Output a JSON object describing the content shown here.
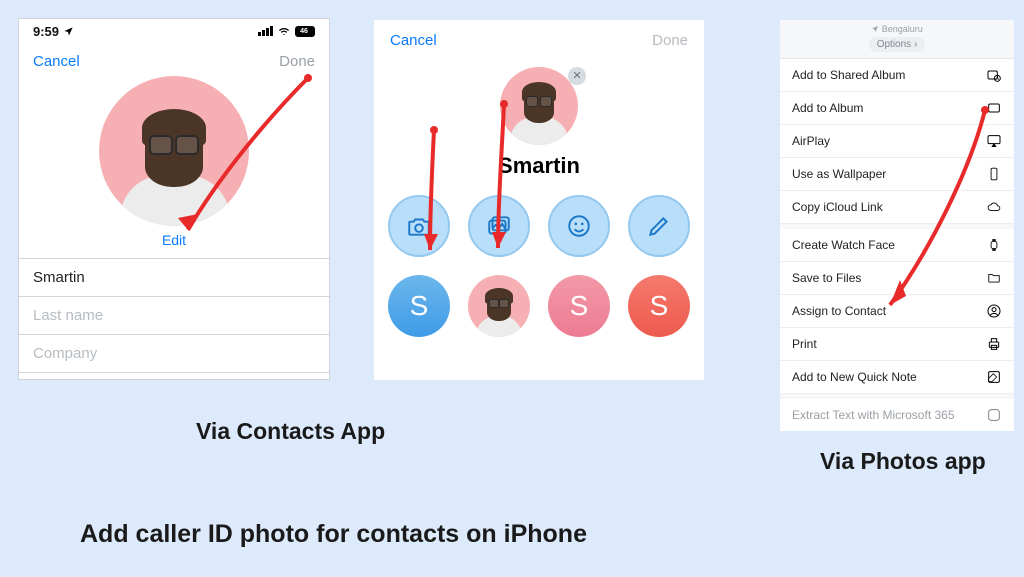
{
  "status": {
    "time": "9:59",
    "battery": "46"
  },
  "panel1": {
    "cancel": "Cancel",
    "done": "Done",
    "edit": "Edit",
    "fields": {
      "first": "Smartin",
      "last_placeholder": "Last name",
      "company_placeholder": "Company"
    }
  },
  "panel2": {
    "cancel": "Cancel",
    "done": "Done",
    "name": "Smartin",
    "initial": "S"
  },
  "panel3": {
    "location": "Bengaluru",
    "options": "Options",
    "items": [
      "Add to Shared Album",
      "Add to Album",
      "AirPlay",
      "Use as Wallpaper",
      "Copy iCloud Link",
      "Create Watch Face",
      "Save to Files",
      "Assign to Contact",
      "Print",
      "Add to New Quick Note",
      "Extract Text with Microsoft 365"
    ]
  },
  "captions": {
    "contacts": "Via Contacts App",
    "photos": "Via Photos app",
    "main": "Add caller ID  photo for contacts on iPhone"
  }
}
